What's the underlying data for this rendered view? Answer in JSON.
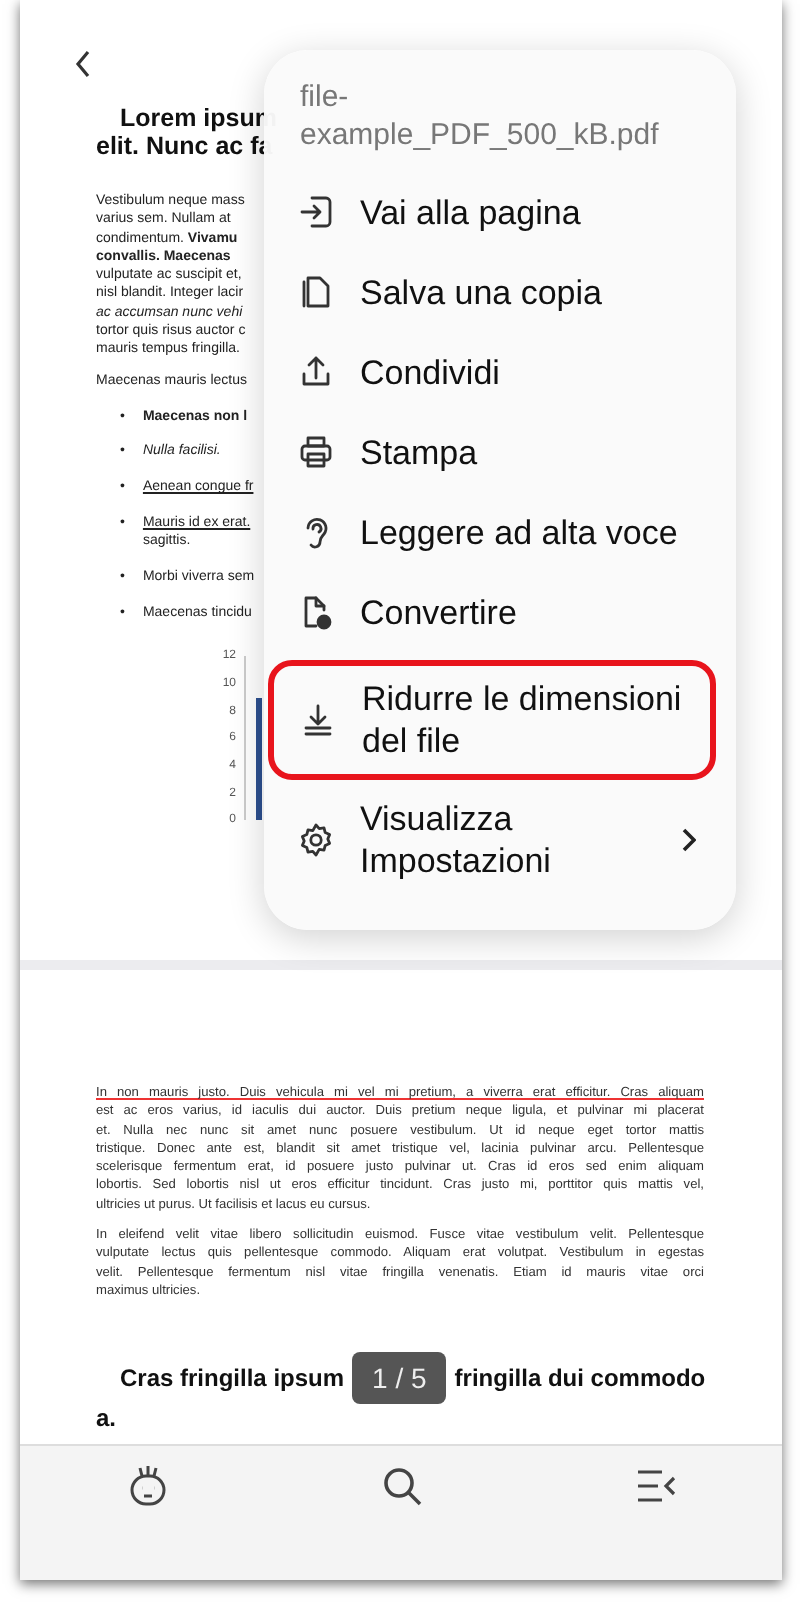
{
  "document": {
    "page1": {
      "heading_lines": [
        "Lorem ipsum",
        "elit. Nunc ac fa"
      ],
      "paragraph_lines": [
        {
          "text": "Vestibulum neque mass",
          "kind": "plain"
        },
        {
          "text": "varius sem. Nullam at",
          "kind": "plain"
        },
        {
          "text": "condimentum. **Vivamu**",
          "kind": "plain"
        },
        {
          "text": "convallis. Maecenas",
          "kind": "strong"
        },
        {
          "text": "vulputate ac suscipit et,",
          "kind": "plain"
        },
        {
          "text": "nisl blandit. Integer lacir",
          "kind": "plain"
        },
        {
          "text": "ac accumsan nunc vehi",
          "kind": "emphasis"
        },
        {
          "text": "tortor quis risus auctor c",
          "kind": "plain"
        },
        {
          "text": "mauris tempus fringilla.",
          "kind": "plain"
        }
      ],
      "paragraph2": "Maecenas mauris lectus",
      "list": [
        {
          "bullet": "•",
          "lines": [
            "Maecenas non l"
          ],
          "kind": "strong"
        },
        {
          "bullet": "•",
          "lines": [
            "Nulla facilisi."
          ],
          "kind": "emphasis"
        },
        {
          "bullet": "•",
          "lines": [
            "Aenean congue fr"
          ],
          "kind": "link"
        },
        {
          "bullet": "•",
          "lines": [
            "Mauris id ex erat.",
            "sagittis."
          ],
          "kind": "link"
        },
        {
          "bullet": "•",
          "lines": [
            "Morbi viverra sem"
          ],
          "kind": "plain"
        },
        {
          "bullet": "•",
          "lines": [
            "Maecenas tincidu"
          ],
          "kind": "plain"
        }
      ],
      "chart": {
        "tick_labels": [
          "12",
          "10",
          "8",
          "6",
          "4",
          "2",
          "0"
        ]
      }
    },
    "page2": {
      "paragraphs": [
        {
          "underlined_first_line": true,
          "lines": [
            "In non mauris justo. Duis vehicula mi vel mi pretium, a viverra erat efficitur. Cras aliquam",
            "est ac eros varius, id iaculis dui auctor. Duis pretium neque ligula, et pulvinar mi placerat",
            "et. Nulla nec nunc sit amet nunc posuere vestibulum. Ut id neque eget tortor mattis",
            "tristique. Donec ante est, blandit sit amet tristique vel, lacinia pulvinar arcu. Pellentesque",
            "scelerisque fermentum erat, id posuere justo pulvinar ut. Cras id eros sed enim aliquam",
            "lobortis. Sed lobortis nisl ut eros efficitur tincidunt. Cras justo mi, porttitor quis mattis vel,",
            "ultricies ut purus. Ut facilisis et lacus eu cursus."
          ]
        },
        {
          "underlined_first_line": false,
          "lines": [
            "In eleifend velit vitae libero sollicitudin euismod. Fusce vitae vestibulum velit. Pellentesque",
            "vulputate lectus quis pellentesque commodo. Aliquam erat volutpat. Vestibulum in egestas",
            "velit. Pellentesque fermentum nisl vitae fringilla venenatis. Etiam id mauris vitae orci",
            "maximus ultricies."
          ]
        }
      ],
      "heading_left": "Cras fringilla ipsum",
      "heading_right": "fringilla dui commodo",
      "heading_end": "a."
    },
    "page_indicator": "1 / 5"
  },
  "menu": {
    "file_name": "file-\nexample_PDF_500_kB.pdf",
    "items": [
      {
        "label": "Vai alla pagina",
        "kind": "goto",
        "highlighted": false,
        "submenu": false
      },
      {
        "label": "Salva una copia",
        "kind": "copy",
        "highlighted": false,
        "submenu": false
      },
      {
        "label": "Condividi",
        "kind": "share",
        "highlighted": false,
        "submenu": false
      },
      {
        "label": "Stampa",
        "kind": "print",
        "highlighted": false,
        "submenu": false
      },
      {
        "label": "Leggere ad alta voce",
        "kind": "ear",
        "highlighted": false,
        "submenu": false
      },
      {
        "label": "Convertire",
        "kind": "convert",
        "highlighted": false,
        "submenu": false
      },
      {
        "label": "Ridurre le dimensioni del file",
        "kind": "compress",
        "highlighted": true,
        "submenu": false
      },
      {
        "label": "Visualizza Impostazioni",
        "kind": "settings",
        "highlighted": false,
        "submenu": true
      }
    ]
  }
}
